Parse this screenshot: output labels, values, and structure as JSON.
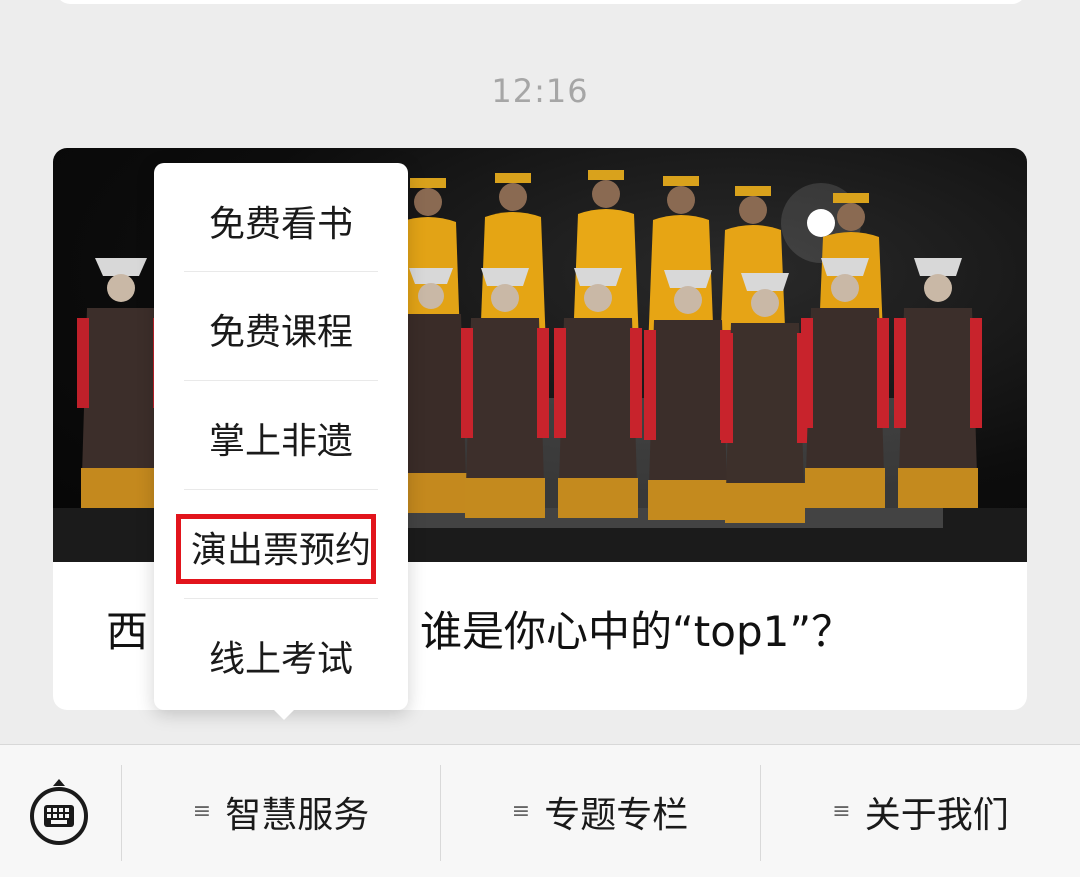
{
  "timestamp": "12:16",
  "article": {
    "title": "西藏…谁是你心中的“top1”？",
    "title_visible_left": "西",
    "title_visible_right": "谁是你心中的“top1”？"
  },
  "menu": {
    "items": [
      {
        "label": "免费看书"
      },
      {
        "label": "免费课程"
      },
      {
        "label": "掌上非遗"
      },
      {
        "label": "演出票预约",
        "highlighted": true
      },
      {
        "label": "线上考试"
      }
    ],
    "highlight_color": "#e2141c"
  },
  "bottom_bar": {
    "keyboard_icon": "keyboard-icon",
    "tabs": [
      {
        "label": "智慧服务",
        "icon": "menu-lines-icon"
      },
      {
        "label": "专题专栏",
        "icon": "menu-lines-icon"
      },
      {
        "label": "关于我们",
        "icon": "menu-lines-icon"
      }
    ]
  },
  "colors": {
    "background": "#ededed",
    "card": "#ffffff",
    "timestamp": "#a6a6a6"
  }
}
